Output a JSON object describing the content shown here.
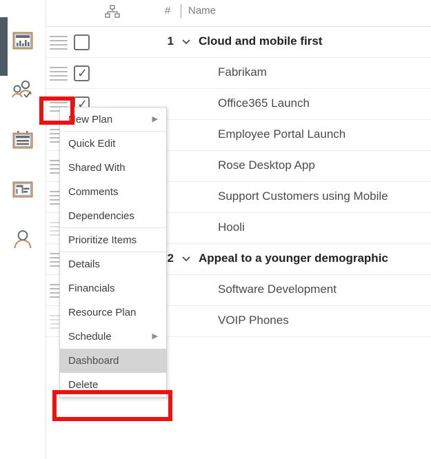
{
  "app": {
    "rail": {
      "selection_color": "#4d5b63",
      "items": [
        {
          "icon": "dashboard-chart-icon",
          "label": "Dashboard"
        },
        {
          "icon": "people-check-icon",
          "label": "Resources"
        },
        {
          "icon": "calendar-icon",
          "label": "Calendar"
        },
        {
          "icon": "gantt-board-icon",
          "label": "Plan Board"
        },
        {
          "icon": "person-icon",
          "label": "Profile"
        }
      ]
    }
  },
  "grid": {
    "header": {
      "hierarchy_icon": "hierarchy-icon",
      "number_label": "#",
      "name_label": "Name"
    },
    "rows": [
      {
        "handle": "drag-handle",
        "checkbox": "unchecked",
        "number": "1",
        "chevron": "chevron-down-icon",
        "name": "Cloud and mobile first",
        "level": "parent"
      },
      {
        "handle": "drag-handle",
        "checkbox": "checked",
        "number": "",
        "chevron": "",
        "name": "Fabrikam",
        "level": "child"
      },
      {
        "handle": "drag-handle",
        "checkbox": "checked-edit",
        "number": "",
        "chevron": "",
        "name": "Office365 Launch",
        "level": "child"
      },
      {
        "handle": "drag-handle",
        "checkbox": "",
        "number": "",
        "chevron": "",
        "name": "Employee Portal Launch",
        "level": "child"
      },
      {
        "handle": "drag-handle",
        "checkbox": "",
        "number": "",
        "chevron": "",
        "name": "Rose Desktop App",
        "level": "child"
      },
      {
        "handle": "drag-handle",
        "checkbox": "",
        "number": "",
        "chevron": "",
        "name": "Support Customers using Mobile",
        "level": "child"
      },
      {
        "handle": "drag-handle-faint",
        "checkbox": "",
        "number": "",
        "chevron": "",
        "name": "Hooli",
        "level": "child"
      },
      {
        "handle": "drag-handle",
        "checkbox": "",
        "number": "2",
        "chevron": "chevron-down-icon",
        "name": "Appeal to a younger demographic",
        "level": "parent"
      },
      {
        "handle": "drag-handle",
        "checkbox": "",
        "number": "",
        "chevron": "",
        "name": "Software Development",
        "level": "child"
      },
      {
        "handle": "drag-handle-faint",
        "checkbox": "",
        "number": "",
        "chevron": "",
        "name": "VOIP Phones",
        "level": "child"
      }
    ]
  },
  "context_menu": {
    "items": [
      {
        "label": "New Plan",
        "submenu": true,
        "separator_after": true,
        "highlight": false
      },
      {
        "label": "Quick Edit",
        "submenu": false,
        "separator_after": false,
        "highlight": false
      },
      {
        "label": "Shared With",
        "submenu": false,
        "separator_after": false,
        "highlight": false
      },
      {
        "label": "Comments",
        "submenu": false,
        "separator_after": false,
        "highlight": false
      },
      {
        "label": "Dependencies",
        "submenu": false,
        "separator_after": true,
        "highlight": false
      },
      {
        "label": "Prioritize Items",
        "submenu": false,
        "separator_after": true,
        "highlight": false
      },
      {
        "label": "Details",
        "submenu": false,
        "separator_after": false,
        "highlight": false
      },
      {
        "label": "Financials",
        "submenu": false,
        "separator_after": false,
        "highlight": false
      },
      {
        "label": "Resource Plan",
        "submenu": false,
        "separator_after": false,
        "highlight": false
      },
      {
        "label": "Schedule",
        "submenu": true,
        "separator_after": false,
        "highlight": false
      },
      {
        "label": "Dashboard",
        "submenu": false,
        "separator_after": false,
        "highlight": true
      },
      {
        "label": "Delete",
        "submenu": false,
        "separator_after": false,
        "highlight": false
      }
    ],
    "submenu_arrow_glyph": "▶"
  },
  "annotations": {
    "color": "#ee1111",
    "boxes": [
      {
        "name": "row-handle-callout"
      },
      {
        "name": "dashboard-menu-callout"
      }
    ]
  }
}
